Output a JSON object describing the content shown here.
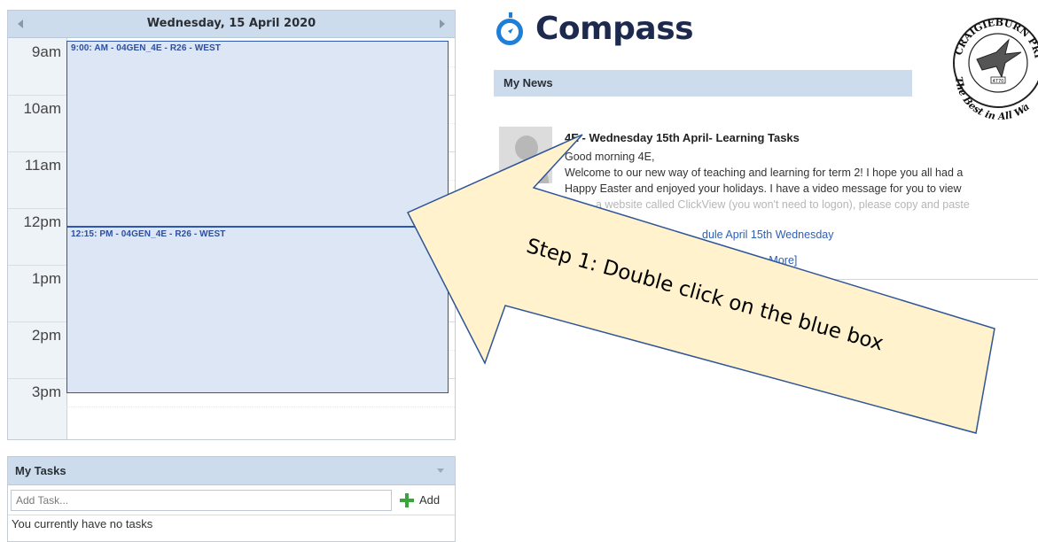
{
  "calendar": {
    "date_title": "Wednesday, 15 April 2020",
    "hours": [
      "9am",
      "10am",
      "11am",
      "12pm",
      "1pm",
      "2pm",
      "3pm"
    ],
    "events": [
      {
        "label": "9:00: AM - 04GEN_4E - R26 - WEST"
      },
      {
        "label": "12:15: PM - 04GEN_4E - R26 - WEST"
      }
    ],
    "colors": {
      "event_fill": "#dce6f4",
      "event_border": "#2e56b0",
      "header_bg": "#cddcec"
    }
  },
  "tasks": {
    "title": "My Tasks",
    "input_placeholder": "Add Task...",
    "add_label": "Add",
    "empty_text": "You currently have no tasks"
  },
  "brand": {
    "logo_text": "Compass",
    "logo_icon": "compass-icon",
    "crest_icon": "school-crest-icon",
    "brand_color": "#1f7fd6"
  },
  "news": {
    "section_title": "My News",
    "item": {
      "title": "4E - Wednesday 15th April- Learning Tasks",
      "lines": [
        "Good morning 4E,",
        "Welcome to our new way of teaching and learning for term 2! I hope you all had a",
        "Happy Easter and enjoyed your holidays. I have a video message for you to view",
        "a website called ClickView (you won't need to logon), please copy and paste"
      ],
      "attachment_link": "dule April 15th Wednesday",
      "more_link": "e More]"
    }
  },
  "annotation": {
    "instruction": "Step 1: Double click on the blue box",
    "arrow_color": "#fff2cc",
    "arrow_border": "#2f5597"
  }
}
